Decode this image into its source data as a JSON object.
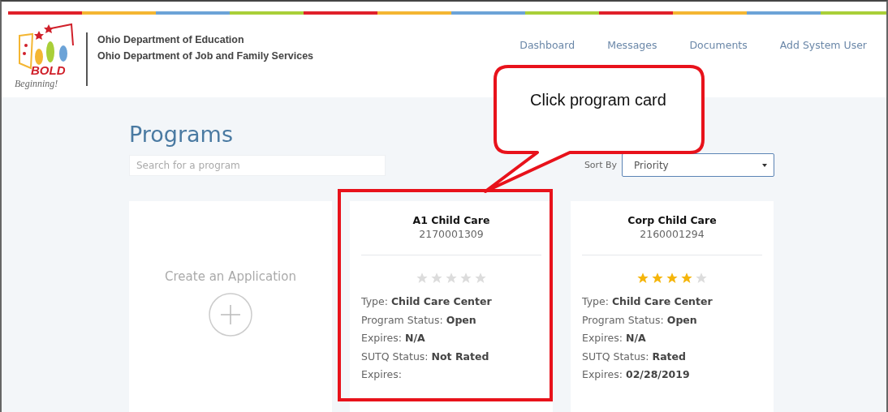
{
  "header": {
    "logo": {
      "word": "BOLD",
      "tagline": "Beginning!"
    },
    "agencies": [
      "Ohio Department of Education",
      "Ohio Department of Job and Family Services"
    ],
    "nav": [
      "Dashboard",
      "Messages",
      "Documents",
      "Add System User"
    ]
  },
  "page": {
    "title": "Programs",
    "search": {
      "placeholder": "Search for a program"
    },
    "sort": {
      "label": "Sort By",
      "value": "Priority"
    }
  },
  "create_card": {
    "label": "Create an Application"
  },
  "cards": [
    {
      "name": "A1 Child Care",
      "number": "2170001309",
      "stars": 0,
      "highlighted": true,
      "fields": [
        {
          "label": "Type:",
          "value": "Child Care Center"
        },
        {
          "label": "Program Status:",
          "value": "Open"
        },
        {
          "label": "Expires:",
          "value": "N/A"
        },
        {
          "label": "SUTQ Status:",
          "value": "Not Rated"
        },
        {
          "label": "Expires:"
        }
      ]
    },
    {
      "name": "Corp Child Care",
      "number": "2160001294",
      "stars": 4,
      "highlighted": false,
      "fields": [
        {
          "label": "Type:",
          "value": "Child Care Center"
        },
        {
          "label": "Program Status:",
          "value": "Open"
        },
        {
          "label": "Expires:",
          "value": "N/A"
        },
        {
          "label": "SUTQ Status:",
          "value": "Rated"
        },
        {
          "label": "Expires:",
          "value": "02/28/2019"
        }
      ]
    }
  ],
  "callout": {
    "text": "Click program card"
  }
}
